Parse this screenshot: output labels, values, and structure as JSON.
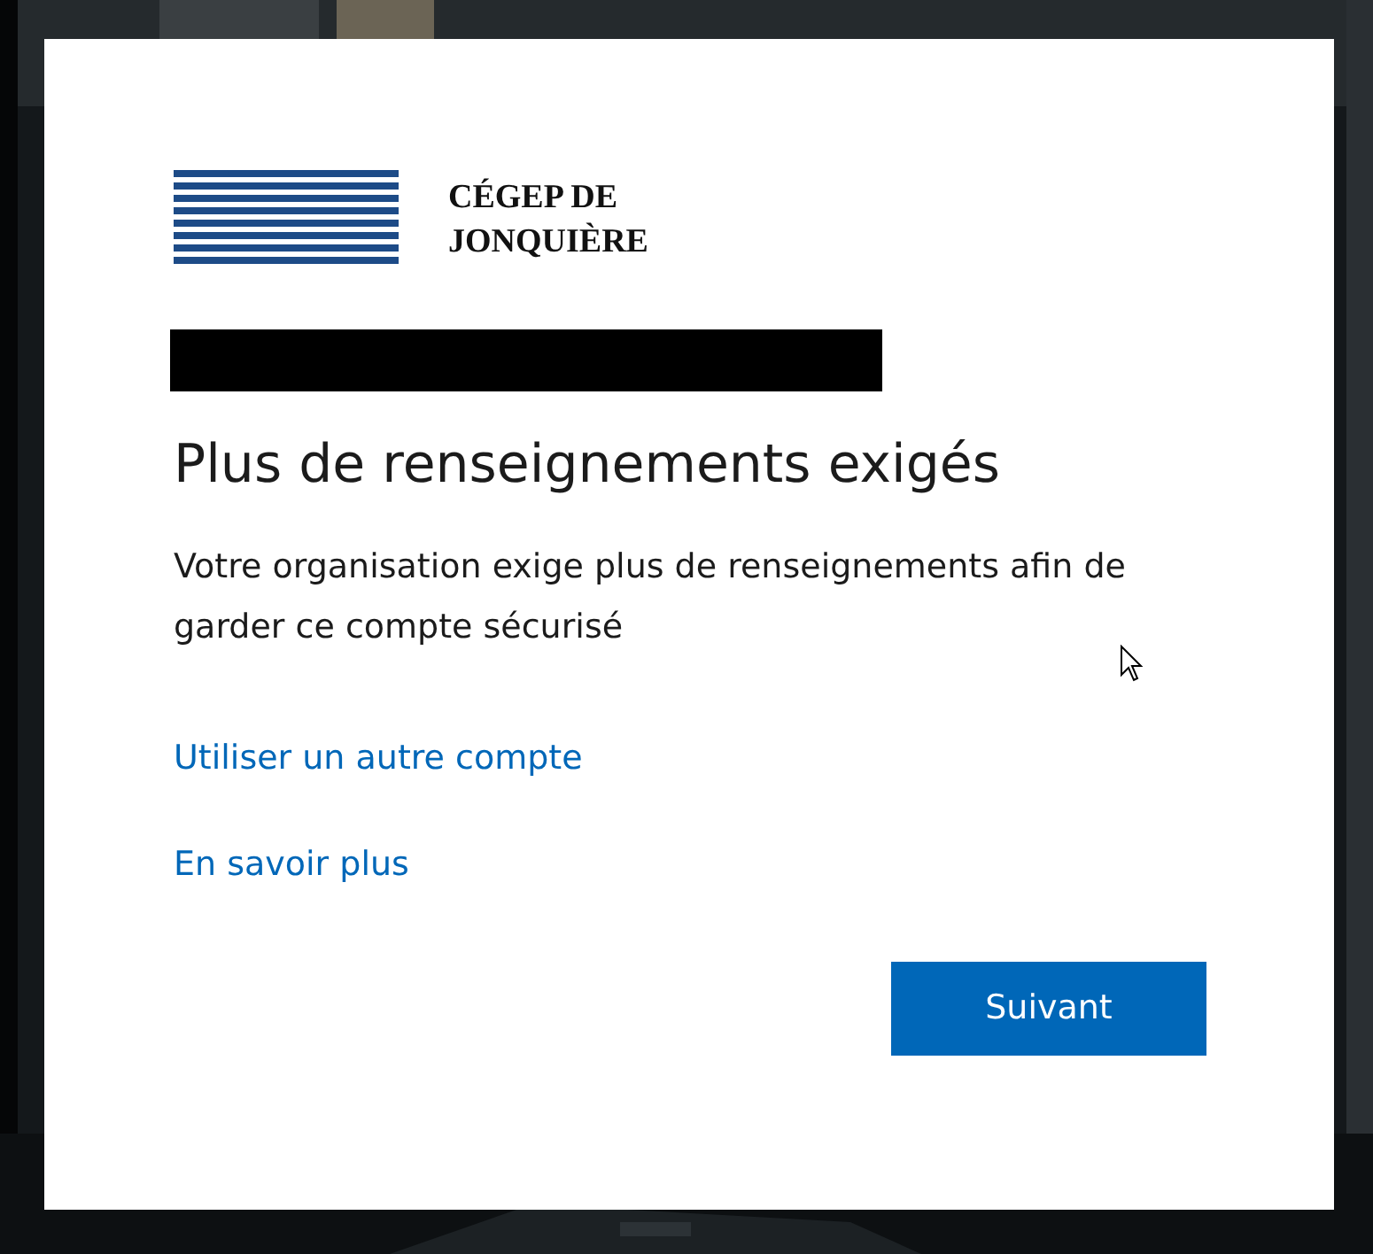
{
  "logo": {
    "line_1": "CÉGEP DE",
    "line_2": "JONQUIÈRE"
  },
  "title": "Plus de renseignements exigés",
  "description": "Votre organisation exige plus de renseignements afin de garder ce compte sécurisé",
  "links": [
    "Utiliser un autre compte",
    "En savoir plus"
  ],
  "button": "Suivant"
}
